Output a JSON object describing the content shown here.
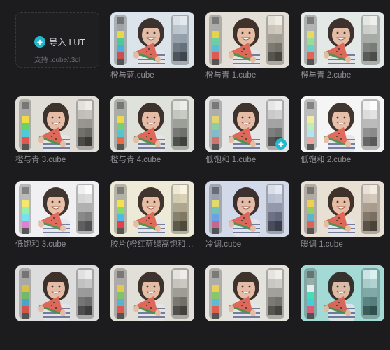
{
  "import": {
    "label": "导入 LUT",
    "note": "支持 .cube/.3dl",
    "icon": "plus-icon"
  },
  "luts": [
    {
      "name": "橙与蓝.cube",
      "tint": "#c9d4e0",
      "strip": [
        "#666",
        "#9b9b9b",
        "#f1d82a",
        "#3dca8d",
        "#3da8e0",
        "#c94040"
      ],
      "ramp": [
        "#e9ecf2",
        "#bfc8d2",
        "#8e98a5",
        "#5a6470",
        "#2c3138"
      ],
      "bg": "#dfe6ed"
    },
    {
      "name": "橙与青 1.cube",
      "tint": "#d8d2c8",
      "strip": [
        "#6d6d6d",
        "#a5a5a5",
        "#e8d43a",
        "#5ccf9e",
        "#4db8d8",
        "#e04a44"
      ],
      "ramp": [
        "#f2efe8",
        "#cfc8bd",
        "#9d978d",
        "#6a655d",
        "#35322d"
      ],
      "bg": "#e6e1d9"
    },
    {
      "name": "橙与青 2.cube",
      "tint": "#cfd8d4",
      "strip": [
        "#707070",
        "#b0b0b0",
        "#e6dc56",
        "#8ee08a",
        "#5ad0cc",
        "#e0584a"
      ],
      "ramp": [
        "#f3f4f1",
        "#d1d4cf",
        "#a1a5a0",
        "#6d716c",
        "#383b37"
      ],
      "bg": "#e6ecea"
    },
    {
      "name": "橙与青 3.cube",
      "tint": "#d8d4cc",
      "strip": [
        "#6a6a6a",
        "#a3a3a3",
        "#f3dc30",
        "#58d25a",
        "#3ccad8",
        "#e44440"
      ],
      "ramp": [
        "#f0eee9",
        "#c2bfba",
        "#8e8b86",
        "#5a5854",
        "#252422"
      ],
      "bg": "#e2dfd9"
    },
    {
      "name": "橙与青 4.cube",
      "tint": "#d4d8d0",
      "strip": [
        "#6a6a6a",
        "#a6a6a6",
        "#eedc3a",
        "#66d06a",
        "#40c4d0",
        "#f05a34"
      ],
      "ramp": [
        "#f1f2ee",
        "#c7c9c3",
        "#959791",
        "#61635e",
        "#2c2d2a"
      ],
      "bg": "#e1e4dd"
    },
    {
      "name": "低饱和 1.cube",
      "tint": "#d8d8d8",
      "strip": [
        "#6b6b6b",
        "#a8a8a8",
        "#e2d466",
        "#84cc9a",
        "#78b8cc",
        "#d06860"
      ],
      "ramp": [
        "#f4f4f4",
        "#cfcfcf",
        "#9c9c9c",
        "#686868",
        "#333333"
      ],
      "bg": "#e8e8e8",
      "add": true
    },
    {
      "name": "低饱和 2.cube",
      "tint": "#f2f2f2",
      "strip": [
        "#757575",
        "#b5b5b5",
        "#f2ec9a",
        "#b8eeb0",
        "#a8e4ec",
        "#f09a94"
      ],
      "ramp": [
        "#ffffff",
        "#e2e2e2",
        "#b4b4b4",
        "#7e7e7e",
        "#454545"
      ],
      "bg": "#f6f6f6"
    },
    {
      "name": "低饱和 3.cube",
      "tint": "#ececf0",
      "strip": [
        "#737373",
        "#b3b3b3",
        "#f5e85a",
        "#8cf0a0",
        "#68e0f0",
        "#e070d0"
      ],
      "ramp": [
        "#fdfdfd",
        "#d9d9d9",
        "#a8a8a8",
        "#727272",
        "#3b3b3b"
      ],
      "bg": "#f1f1f4"
    },
    {
      "name": "胶片(橙红蓝绿高饱和).cube",
      "tint": "#e8e4cc",
      "strip": [
        "#6f6f6f",
        "#a9a9a9",
        "#f6e23a",
        "#7ad85a",
        "#3ab6ea",
        "#e82a3c"
      ],
      "ramp": [
        "#fbf6e4",
        "#d8cfb3",
        "#a79e84",
        "#716a55",
        "#3a3629"
      ],
      "bg": "#eeecda"
    },
    {
      "name": "冷调.cube",
      "tint": "#c4cce0",
      "strip": [
        "#5c5f6b",
        "#9499a8",
        "#e8dc60",
        "#6ac0b0",
        "#5a9ee6",
        "#c45a88"
      ],
      "ramp": [
        "#e8ecf6",
        "#bcc3d4",
        "#8b92a5",
        "#575d70",
        "#262a38"
      ],
      "bg": "#d4dbea"
    },
    {
      "name": "暖调 1.cube",
      "tint": "#e0d4c8",
      "strip": [
        "#6d6a66",
        "#a9a49e",
        "#f0d040",
        "#8acb5c",
        "#50aed0",
        "#e05444"
      ],
      "ramp": [
        "#f6efe6",
        "#d3c8ba",
        "#a29585",
        "#6e6253",
        "#382f25"
      ],
      "bg": "#ebe2d7"
    },
    {
      "name": "",
      "tint": "#d0d0d0",
      "strip": [
        "#686868",
        "#a3a3a3",
        "#d8be3a",
        "#66b85a",
        "#3aa0c8",
        "#d0453c"
      ],
      "ramp": [
        "#f0f0f0",
        "#c6c6c6",
        "#939393",
        "#5f5f5f",
        "#2a2a2a"
      ],
      "bg": "#e0e0e0"
    },
    {
      "name": "",
      "tint": "#d6d2cc",
      "strip": [
        "#6c6c6c",
        "#a5a5a5",
        "#e6c83a",
        "#72c25c",
        "#48aed4",
        "#dc4a3e"
      ],
      "ramp": [
        "#f3f1ed",
        "#cac6c0",
        "#98948e",
        "#64615c",
        "#2f2d2a"
      ],
      "bg": "#e4e0da"
    },
    {
      "name": "",
      "tint": "#d4d2cc",
      "strip": [
        "#6e6e6e",
        "#a8a8a8",
        "#ecd04a",
        "#7cc860",
        "#52b6d8",
        "#e2503e"
      ],
      "ramp": [
        "#f3f2ef",
        "#cdcbc6",
        "#9b9994",
        "#67655f",
        "#32312d"
      ],
      "bg": "#e6e4de"
    },
    {
      "name": "",
      "tint": "#8ad0cc",
      "strip": [
        "#5e6a68",
        "#9aa8a6",
        "#f4f0f0",
        "#40e0b0",
        "#38d0e0",
        "#f04a6a"
      ],
      "ramp": [
        "#e4f6f4",
        "#b4d4d2",
        "#80a4a2",
        "#4e7472",
        "#223e3c"
      ],
      "bg": "#a8dcd8"
    }
  ]
}
